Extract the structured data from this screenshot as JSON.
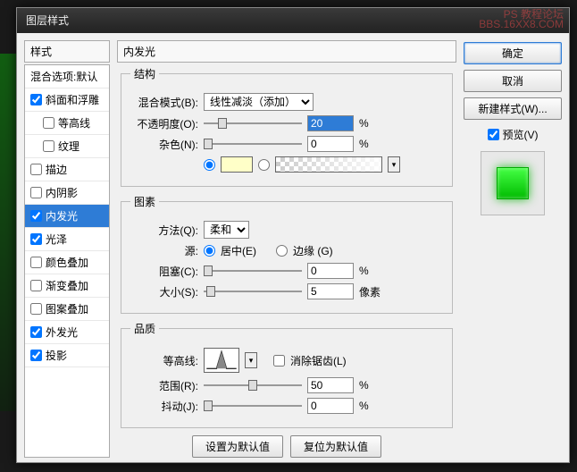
{
  "watermark": {
    "line1": "PS 教程论坛",
    "line2": "BBS.16XX8.COM"
  },
  "title": "图层样式",
  "stylesPanel": {
    "header": "样式"
  },
  "styles": [
    {
      "label": "混合选项:默认",
      "checkbox": false,
      "indent": false
    },
    {
      "label": "斜面和浮雕",
      "checkbox": true,
      "checked": true,
      "indent": false
    },
    {
      "label": "等高线",
      "checkbox": true,
      "checked": false,
      "indent": true
    },
    {
      "label": "纹理",
      "checkbox": true,
      "checked": false,
      "indent": true
    },
    {
      "label": "描边",
      "checkbox": true,
      "checked": false,
      "indent": false
    },
    {
      "label": "内阴影",
      "checkbox": true,
      "checked": false,
      "indent": false
    },
    {
      "label": "内发光",
      "checkbox": true,
      "checked": true,
      "indent": false,
      "selected": true
    },
    {
      "label": "光泽",
      "checkbox": true,
      "checked": true,
      "indent": false
    },
    {
      "label": "颜色叠加",
      "checkbox": true,
      "checked": false,
      "indent": false
    },
    {
      "label": "渐变叠加",
      "checkbox": true,
      "checked": false,
      "indent": false
    },
    {
      "label": "图案叠加",
      "checkbox": true,
      "checked": false,
      "indent": false
    },
    {
      "label": "外发光",
      "checkbox": true,
      "checked": true,
      "indent": false
    },
    {
      "label": "投影",
      "checkbox": true,
      "checked": true,
      "indent": false
    }
  ],
  "centerHeader": "内发光",
  "structure": {
    "legend": "结构",
    "blendModeLabel": "混合模式(B):",
    "blendModeValue": "线性减淡（添加）",
    "opacityLabel": "不透明度(O):",
    "opacityValue": "20",
    "opacityUnit": "%",
    "noiseLabel": "杂色(N):",
    "noiseValue": "0",
    "noiseUnit": "%"
  },
  "elements": {
    "legend": "图素",
    "methodLabel": "方法(Q):",
    "methodValue": "柔和",
    "sourceLabel": "源:",
    "sourceCenter": "居中(E)",
    "sourceEdge": "边缘 (G)",
    "chokeLabel": "阻塞(C):",
    "chokeValue": "0",
    "chokeUnit": "%",
    "sizeLabel": "大小(S):",
    "sizeValue": "5",
    "sizeUnit": "像素"
  },
  "quality": {
    "legend": "品质",
    "contourLabel": "等高线:",
    "antiAlias": "消除锯齿(L)",
    "rangeLabel": "范围(R):",
    "rangeValue": "50",
    "rangeUnit": "%",
    "jitterLabel": "抖动(J):",
    "jitterValue": "0",
    "jitterUnit": "%"
  },
  "bottomButtons": {
    "default": "设置为默认值",
    "reset": "复位为默认值"
  },
  "rightPanel": {
    "ok": "确定",
    "cancel": "取消",
    "newStyle": "新建样式(W)...",
    "preview": "预览(V)"
  }
}
